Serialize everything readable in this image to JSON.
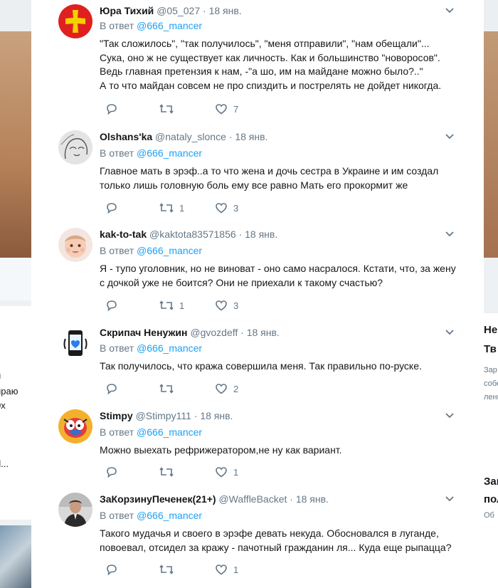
{
  "background": {
    "left_fragments": [
      "й",
      "ираю",
      "0х",
      "d..."
    ],
    "right_fragments": [
      "Не",
      "Тв",
      "Зар",
      "собе",
      "лень",
      "Зав",
      "пол",
      "Об"
    ]
  },
  "tweets": [
    {
      "name": "Юра Тихий",
      "handle": "@05_027",
      "sep": "·",
      "date": "18 янв.",
      "reply_prefix": "В ответ",
      "reply_to": "@666_mancer",
      "lines": [
        "\"Так сложилось\", \"так получилось\", \"меня отправили\", \"нам обещали\"...",
        "Сука, оно ж не существует как личность. Как и большинство \"новоросов\".",
        "Ведь главная претензия к нам, -\"а шо, им на майдане можно было?..\"",
        "А то что майдан совсем не про спиздить и пострелять не дойдет никогда."
      ],
      "replies": "",
      "retweets": "",
      "likes": "7",
      "avatar": "red-cross-flag"
    },
    {
      "name": "Olshans'ka",
      "handle": "@nataly_slonce",
      "sep": "·",
      "date": "18 янв.",
      "reply_prefix": "В ответ",
      "reply_to": "@666_mancer",
      "lines": [
        "Главное мать в эрэф..а то что жена и дочь сестра в Украине и им создал",
        "только лишь головную боль ему все равно Мать его  прокормит же"
      ],
      "replies": "",
      "retweets": "1",
      "likes": "3",
      "avatar": "sketch-face"
    },
    {
      "name": "kak-to-tak",
      "handle": "@kaktota83571856",
      "sep": "·",
      "date": "18 янв.",
      "reply_prefix": "В ответ",
      "reply_to": "@666_mancer",
      "lines": [
        "Я - тупо уголовник, но не виноват - оно само насралося. Кстати, что, за жену",
        "с дочкой уже не боится? Они не приехали к такому счастью?"
      ],
      "replies": "",
      "retweets": "1",
      "likes": "3",
      "avatar": "baby-photo"
    },
    {
      "name": "Скрипач Ненужин",
      "handle": "@gvozdeff",
      "sep": "·",
      "date": "18 янв.",
      "reply_prefix": "В ответ",
      "reply_to": "@666_mancer",
      "lines": [
        "Так получилось, что кража совершила меня. Так правильно по-руске."
      ],
      "replies": "",
      "retweets": "",
      "likes": "2",
      "avatar": "phone-heart"
    },
    {
      "name": "Stimpy",
      "handle": "@Stimpy111",
      "sep": "·",
      "date": "18 янв.",
      "reply_prefix": "В ответ",
      "reply_to": "@666_mancer",
      "lines": [
        "Можно выехать рефрижератором,не ну как вариант."
      ],
      "replies": "",
      "retweets": "",
      "likes": "1",
      "avatar": "cartoon-cat"
    },
    {
      "name": "ЗаКорзинуПеченек(21+)",
      "handle": "@WaffleBacket",
      "sep": "·",
      "date": "18 янв.",
      "reply_prefix": "В ответ",
      "reply_to": "@666_mancer",
      "lines": [
        "Такого мудачья и своего в эрэфе девать некуда. Обосновался в луганде,",
        "повоевал, отсидел за кражу - пачотный гражданин ля... Куда еще рыпацца?"
      ],
      "replies": "",
      "retweets": "",
      "likes": "1",
      "avatar": "man-portrait"
    }
  ],
  "colors": {
    "accent": "#1da1f2",
    "secondary_text": "#657786",
    "primary_text": "#14171a",
    "divider": "#e6ecf0"
  }
}
